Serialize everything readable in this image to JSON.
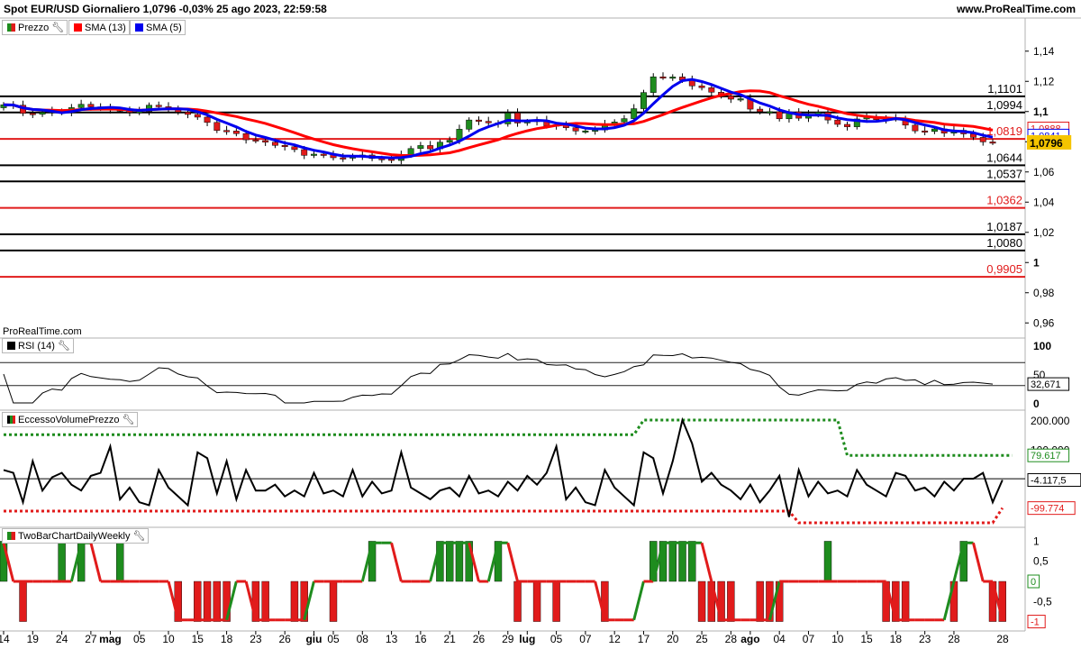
{
  "header": {
    "title": "Spot EUR/USD Giornaliero 1,0796 -0,03% 25 ago 2023, 22:59:58",
    "site": "www.ProRealTime.com",
    "watermark": "ProRealTime.com"
  },
  "colors": {
    "up": "#1e8c1e",
    "down": "#e11b1b",
    "sma13": "#ff0000",
    "sma5": "#0000ee",
    "last_price_bg": "#f5c400"
  },
  "legends": {
    "price": {
      "label": "Prezzo",
      "icon": "wrench-icon"
    },
    "sma13": {
      "label": "SMA (13)"
    },
    "sma5": {
      "label": "SMA (5)"
    },
    "rsi": {
      "label": "RSI (14)"
    },
    "evp": {
      "label": "EccessoVolumePrezzo"
    },
    "twobar": {
      "label": "TwoBarChartDailyWeekly"
    }
  },
  "chart_data": [
    {
      "type": "candlestick",
      "name": "price",
      "ylim": [
        0.95,
        1.15
      ],
      "yticks": [
        {
          "v": 1.14,
          "label": "1,14"
        },
        {
          "v": 1.12,
          "label": "1,12"
        },
        {
          "v": 1.1,
          "label": "1,1"
        },
        {
          "v": 1.08,
          "label": "1,08"
        },
        {
          "v": 1.06,
          "label": "1,06"
        },
        {
          "v": 1.04,
          "label": "1,04"
        },
        {
          "v": 1.02,
          "label": "1,02"
        },
        {
          "v": 1.0,
          "label": "1"
        },
        {
          "v": 0.98,
          "label": "0,98"
        },
        {
          "v": 0.96,
          "label": "0,96"
        }
      ],
      "levels": [
        {
          "v": 1.1101,
          "label": "1,1101",
          "color": "#000000"
        },
        {
          "v": 1.0994,
          "label": "1,0994",
          "color": "#000000"
        },
        {
          "v": 1.0819,
          "label": "1,0819",
          "color": "#e11b1b"
        },
        {
          "v": 1.0644,
          "label": "1,0644",
          "color": "#000000"
        },
        {
          "v": 1.0537,
          "label": "1,0537",
          "color": "#000000"
        },
        {
          "v": 1.0362,
          "label": "1,0362",
          "color": "#e11b1b"
        },
        {
          "v": 1.0187,
          "label": "1,0187",
          "color": "#000000"
        },
        {
          "v": 1.008,
          "label": "1,0080",
          "color": "#000000"
        },
        {
          "v": 0.9905,
          "label": "0,9905",
          "color": "#e11b1b"
        }
      ],
      "axis_tags": [
        {
          "v": 1.0888,
          "label": "1,0888",
          "color": "#e11b1b"
        },
        {
          "v": 1.0841,
          "label": "1,0841",
          "color": "#0000ee"
        },
        {
          "v": 1.0796,
          "label": "1,0796",
          "color": "#f5c400"
        }
      ],
      "closes": [
        1.1045,
        1.1042,
        1.0988,
        1.0982,
        1.0995,
        1.1002,
        1.0994,
        1.1026,
        1.1048,
        1.1031,
        1.1022,
        1.1012,
        1.1009,
        1.0994,
        1.1001,
        1.1042,
        1.1032,
        1.1021,
        1.0996,
        1.0981,
        1.0963,
        1.0928,
        1.0875,
        1.0871,
        1.0854,
        1.0813,
        1.0808,
        1.0797,
        1.0776,
        1.0767,
        1.0748,
        1.071,
        1.0718,
        1.0717,
        1.0694,
        1.0691,
        1.0704,
        1.0712,
        1.0689,
        1.0686,
        1.0676,
        1.0711,
        1.0755,
        1.0775,
        1.0753,
        1.0797,
        1.081,
        1.0883,
        1.0944,
        1.0935,
        1.0925,
        1.0918,
        1.0991,
        1.0924,
        1.0933,
        1.0942,
        1.0905,
        1.0912,
        1.0893,
        1.0871,
        1.0872,
        1.0878,
        1.0915,
        1.0931,
        1.0953,
        1.1019,
        1.1126,
        1.123,
        1.1228,
        1.1229,
        1.1208,
        1.117,
        1.1158,
        1.1128,
        1.1104,
        1.1082,
        1.1085,
        1.1016,
        1.0999,
        1.0999,
        1.0952,
        1.0998,
        1.0956,
        1.098,
        1.0995,
        1.0944,
        1.0915,
        1.0899,
        1.0951,
        1.0965,
        1.0946,
        1.0952,
        1.0954,
        1.091,
        1.0872,
        1.0868,
        1.0885,
        1.0857,
        1.0876,
        1.0852,
        1.0829,
        1.0799,
        1.0796
      ]
    },
    {
      "type": "line",
      "name": "rsi",
      "ylim": [
        0,
        100
      ],
      "yticks": [
        {
          "v": 100,
          "label": "100"
        },
        {
          "v": 50,
          "label": "50"
        },
        {
          "v": 0,
          "label": "0"
        }
      ],
      "bands": [
        70,
        30
      ],
      "last": {
        "v": 32.671,
        "label": "32,671"
      }
    },
    {
      "type": "line",
      "name": "eccesso_volume_prezzo",
      "ylim": [
        -150000,
        200000
      ],
      "yticks": [
        {
          "v": 200000,
          "label": "200.000"
        },
        {
          "v": 100000,
          "label": "100.000"
        },
        {
          "v": 0,
          "label": "0"
        }
      ],
      "tags": [
        {
          "v": 79617,
          "label": "79.617",
          "color": "#1e8c1e"
        },
        {
          "v": -4117.5,
          "label": "-4.117,5",
          "color": "#000000"
        },
        {
          "v": -99774,
          "label": "-99.774",
          "color": "#e11b1b"
        }
      ],
      "values": [
        30000,
        20000,
        -80000,
        60000,
        -40000,
        5000,
        20000,
        -20000,
        -40000,
        10000,
        20000,
        110000,
        -70000,
        -30000,
        -80000,
        -90000,
        30000,
        -30000,
        -60000,
        -90000,
        90000,
        70000,
        -50000,
        60000,
        -70000,
        30000,
        -40000,
        -40000,
        -20000,
        -60000,
        -40000,
        -60000,
        20000,
        -50000,
        -40000,
        -60000,
        30000,
        -60000,
        -10000,
        -50000,
        -40000,
        90000,
        -30000,
        -50000,
        -70000,
        -40000,
        -30000,
        -60000,
        10000,
        -50000,
        -40000,
        -60000,
        -10000,
        -40000,
        10000,
        -20000,
        20000,
        110000,
        -70000,
        -30000,
        -80000,
        -90000,
        30000,
        -30000,
        -60000,
        -90000,
        90000,
        70000,
        -50000,
        60000,
        200000,
        120000,
        -10000,
        20000,
        -20000,
        -40000,
        -70000,
        -20000,
        -80000,
        -40000,
        10000,
        -130000,
        30000,
        -60000,
        -10000,
        -50000,
        -40000,
        -60000,
        30000,
        -20000,
        -40000,
        -60000,
        20000,
        10000,
        -40000,
        -30000,
        -60000,
        -10000,
        -40000,
        0,
        0,
        20000,
        -80000,
        -4117.5
      ],
      "upper": [
        150000,
        150000,
        150000,
        150000,
        150000,
        150000,
        150000,
        150000,
        150000,
        150000,
        150000,
        150000,
        150000,
        150000,
        150000,
        150000,
        150000,
        150000,
        150000,
        150000,
        150000,
        150000,
        150000,
        150000,
        150000,
        150000,
        150000,
        150000,
        150000,
        150000,
        150000,
        150000,
        150000,
        150000,
        150000,
        150000,
        150000,
        150000,
        150000,
        150000,
        150000,
        150000,
        150000,
        150000,
        150000,
        150000,
        150000,
        150000,
        150000,
        150000,
        150000,
        150000,
        150000,
        150000,
        150000,
        150000,
        150000,
        150000,
        150000,
        150000,
        150000,
        150000,
        150000,
        150000,
        150000,
        150000,
        200000,
        200000,
        200000,
        200000,
        200000,
        200000,
        200000,
        200000,
        200000,
        200000,
        200000,
        200000,
        200000,
        200000,
        200000,
        200000,
        200000,
        200000,
        200000,
        200000,
        200000,
        79617,
        79617,
        79617,
        79617,
        79617,
        79617,
        79617,
        79617,
        79617,
        79617,
        79617,
        79617,
        79617,
        79617,
        79617,
        79617,
        79617,
        79617
      ],
      "lower": [
        -110000,
        -110000,
        -110000,
        -110000,
        -110000,
        -110000,
        -110000,
        -110000,
        -110000,
        -110000,
        -110000,
        -110000,
        -110000,
        -110000,
        -110000,
        -110000,
        -110000,
        -110000,
        -110000,
        -110000,
        -110000,
        -110000,
        -110000,
        -110000,
        -110000,
        -110000,
        -110000,
        -110000,
        -110000,
        -110000,
        -110000,
        -110000,
        -110000,
        -110000,
        -110000,
        -110000,
        -110000,
        -110000,
        -110000,
        -110000,
        -110000,
        -110000,
        -110000,
        -110000,
        -110000,
        -110000,
        -110000,
        -110000,
        -110000,
        -110000,
        -110000,
        -110000,
        -110000,
        -110000,
        -110000,
        -110000,
        -110000,
        -110000,
        -110000,
        -110000,
        -110000,
        -110000,
        -110000,
        -110000,
        -110000,
        -110000,
        -110000,
        -110000,
        -110000,
        -110000,
        -110000,
        -110000,
        -110000,
        -110000,
        -110000,
        -110000,
        -110000,
        -110000,
        -110000,
        -110000,
        -110000,
        -110000,
        -150000,
        -150000,
        -150000,
        -150000,
        -150000,
        -150000,
        -150000,
        -150000,
        -150000,
        -150000,
        -150000,
        -150000,
        -150000,
        -150000,
        -150000,
        -150000,
        -150000,
        -150000,
        -150000,
        -150000,
        -150000,
        -99774
      ]
    },
    {
      "type": "bar",
      "name": "two_bar_chart_daily_weekly",
      "ylim": [
        -1.1,
        1.1
      ],
      "yticks": [
        {
          "v": 1,
          "label": "1"
        },
        {
          "v": 0.5,
          "label": "0,5"
        },
        {
          "v": -0.5,
          "label": "-0,5"
        }
      ],
      "tags": [
        {
          "v": 0,
          "label": "0",
          "color": "#1e8c1e"
        },
        {
          "v": -1,
          "label": "-1",
          "color": "#e11b1b"
        }
      ],
      "bars": [
        1,
        0,
        -1,
        0,
        0,
        0,
        1,
        0,
        1,
        0,
        0,
        0,
        1,
        0,
        0,
        0,
        0,
        0,
        -1,
        0,
        -1,
        -1,
        -1,
        -1,
        0,
        0,
        -1,
        -1,
        0,
        0,
        -1,
        -1,
        0,
        0,
        -1,
        0,
        0,
        0,
        1,
        0,
        0,
        0,
        0,
        0,
        0,
        1,
        1,
        1,
        1,
        0,
        0,
        1,
        0,
        -1,
        0,
        -1,
        0,
        -1,
        0,
        0,
        0,
        0,
        -1,
        0,
        0,
        0,
        0,
        1,
        1,
        1,
        1,
        1,
        -1,
        -1,
        -1,
        -1,
        0,
        0,
        -1,
        -1,
        -1,
        0,
        0,
        0,
        0,
        1,
        0,
        0,
        0,
        0,
        0,
        -1,
        -1,
        -1,
        0,
        0,
        0,
        0,
        -1,
        1,
        0,
        0,
        -1,
        -1
      ],
      "line": [
        1,
        0,
        0,
        0,
        0,
        0,
        0,
        0,
        1,
        1,
        0,
        0,
        0,
        0,
        0,
        0,
        0,
        0,
        -1,
        -1,
        -1,
        -1,
        -1,
        -1,
        0,
        0,
        -1,
        -1,
        -1,
        -1,
        -1,
        -1,
        0,
        0,
        0,
        0,
        0,
        0,
        1,
        1,
        1,
        0,
        0,
        0,
        0,
        1,
        1,
        1,
        1,
        0,
        0,
        1,
        1,
        0,
        0,
        0,
        0,
        0,
        0,
        0,
        0,
        0,
        -1,
        -1,
        -1,
        -1,
        0,
        0,
        1,
        1,
        1,
        1,
        1,
        0,
        -1,
        -1,
        -1,
        -1,
        -1,
        -1,
        0,
        0,
        0,
        0,
        0,
        0,
        0,
        0,
        0,
        0,
        0,
        0,
        -1,
        -1,
        -1,
        -1,
        -1,
        -1,
        0,
        1,
        1,
        0,
        0,
        -1
      ]
    }
  ],
  "x_axis": {
    "labels": [
      {
        "i": 0,
        "label": "14"
      },
      {
        "i": 3,
        "label": "19"
      },
      {
        "i": 6,
        "label": "24"
      },
      {
        "i": 9,
        "label": "27"
      },
      {
        "i": 11,
        "label": "mag"
      },
      {
        "i": 14,
        "label": "05"
      },
      {
        "i": 17,
        "label": "10"
      },
      {
        "i": 20,
        "label": "15"
      },
      {
        "i": 23,
        "label": "18"
      },
      {
        "i": 26,
        "label": "23"
      },
      {
        "i": 29,
        "label": "26"
      },
      {
        "i": 32,
        "label": "giu"
      },
      {
        "i": 34,
        "label": "05"
      },
      {
        "i": 37,
        "label": "08"
      },
      {
        "i": 40,
        "label": "13"
      },
      {
        "i": 43,
        "label": "16"
      },
      {
        "i": 46,
        "label": "21"
      },
      {
        "i": 49,
        "label": "26"
      },
      {
        "i": 52,
        "label": "29"
      },
      {
        "i": 54,
        "label": "lug"
      },
      {
        "i": 57,
        "label": "05"
      },
      {
        "i": 60,
        "label": "07"
      },
      {
        "i": 63,
        "label": "12"
      },
      {
        "i": 66,
        "label": "17"
      },
      {
        "i": 69,
        "label": "20"
      },
      {
        "i": 72,
        "label": "25"
      },
      {
        "i": 75,
        "label": "28"
      },
      {
        "i": 77,
        "label": "ago"
      },
      {
        "i": 80,
        "label": "04"
      },
      {
        "i": 83,
        "label": "07"
      },
      {
        "i": 86,
        "label": "10"
      },
      {
        "i": 89,
        "label": "15"
      },
      {
        "i": 92,
        "label": "18"
      },
      {
        "i": 95,
        "label": "23"
      },
      {
        "i": 98,
        "label": "28"
      }
    ]
  }
}
